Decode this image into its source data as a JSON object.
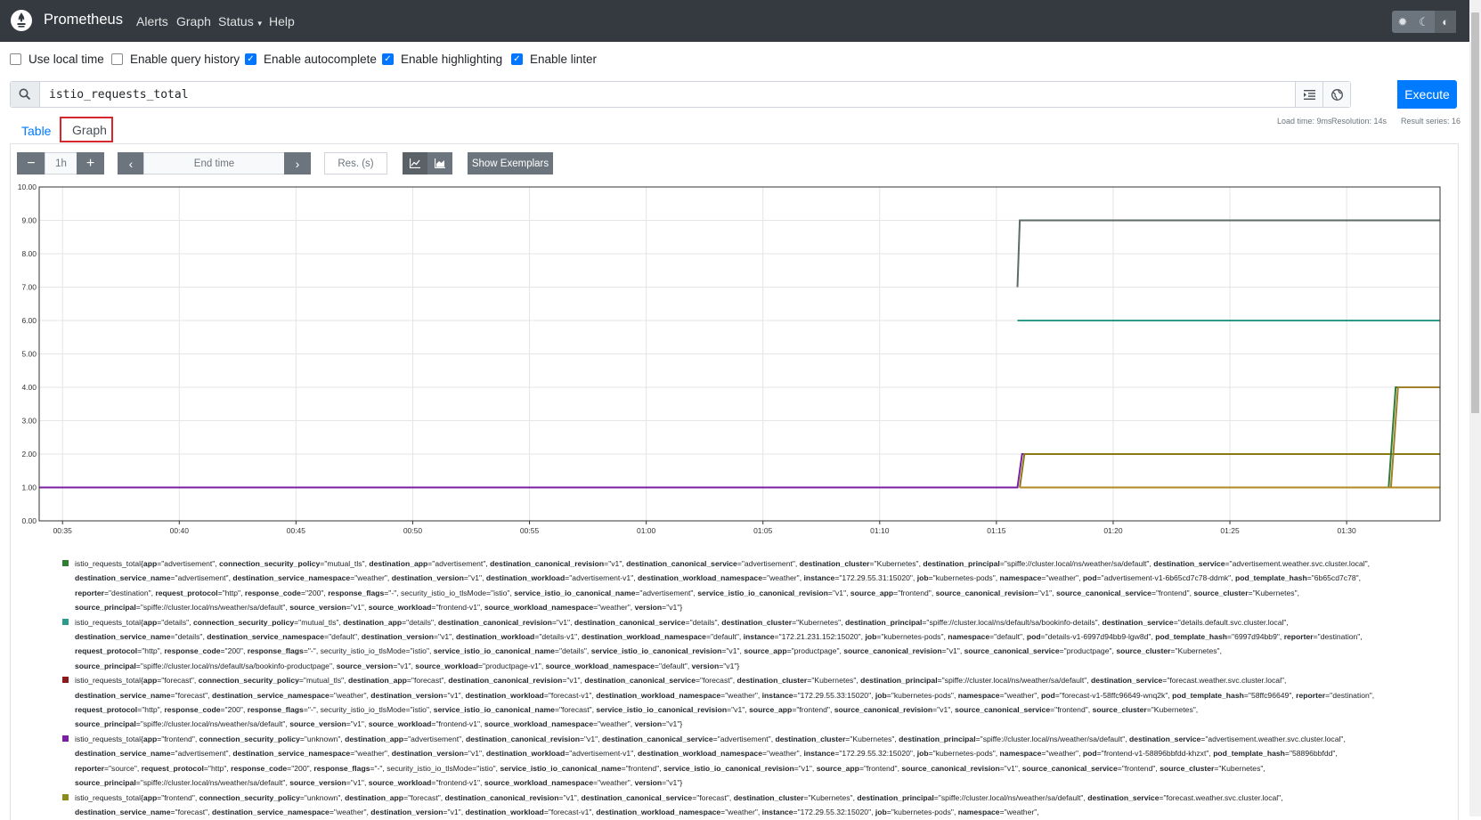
{
  "navbar": {
    "brand": "Prometheus",
    "links": [
      "Alerts",
      "Graph",
      "Status",
      "Help"
    ]
  },
  "options": [
    {
      "label": "Use local time",
      "checked": false
    },
    {
      "label": "Enable query history",
      "checked": false
    },
    {
      "label": "Enable autocomplete",
      "checked": true
    },
    {
      "label": "Enable highlighting",
      "checked": true
    },
    {
      "label": "Enable linter",
      "checked": true
    }
  ],
  "expression": "istio_requests_total",
  "execute_label": "Execute",
  "tabs": [
    "Table",
    "Graph"
  ],
  "stats": {
    "load_time": "Load time: 9ms",
    "resolution": "Resolution: 14s",
    "result_series": "Result series: 16"
  },
  "controls": {
    "range": "1h",
    "end_time_placeholder": "End time",
    "res_placeholder": "Res. (s)",
    "exemplars_label": "Show Exemplars"
  },
  "colors": {
    "execute": "#007bff",
    "navbar": "#343a40"
  },
  "chart_data": {
    "type": "line",
    "y_ticks": [
      "0.00",
      "1.00",
      "2.00",
      "3.00",
      "4.00",
      "5.00",
      "6.00",
      "7.00",
      "8.00",
      "9.00",
      "10.00"
    ],
    "x_ticks": [
      "00:35",
      "00:40",
      "00:45",
      "00:50",
      "00:55",
      "01:00",
      "01:05",
      "01:10",
      "01:15",
      "01:20",
      "01:25",
      "01:30"
    ],
    "ylim": [
      0,
      10
    ],
    "series": [
      {
        "color": "#5f6a68",
        "points": [
          [
            "01:15.9",
            7
          ],
          [
            "01:16.0",
            9
          ],
          [
            "01:34",
            9
          ]
        ]
      },
      {
        "color": "#2d9a8a",
        "points": [
          [
            "01:15.9",
            6
          ],
          [
            "01:34",
            6
          ]
        ]
      },
      {
        "color": "#7b1fa2",
        "points": [
          [
            "00:34",
            1
          ],
          [
            "01:15.9",
            1
          ],
          [
            "01:16.1",
            2
          ],
          [
            "01:34",
            2
          ]
        ]
      },
      {
        "color": "#8b7a14",
        "points": [
          [
            "01:16.0",
            1
          ],
          [
            "01:16.2",
            2
          ],
          [
            "01:34",
            2
          ]
        ]
      },
      {
        "color": "#2e7d32",
        "points": [
          [
            "01:31.8",
            1
          ],
          [
            "01:32.1",
            4
          ],
          [
            "01:34",
            4
          ]
        ]
      },
      {
        "color": "#a0802a",
        "points": [
          [
            "01:31.9",
            1
          ],
          [
            "01:32.2",
            4
          ],
          [
            "01:34",
            4
          ]
        ]
      },
      {
        "color": "#b08a20",
        "points": [
          [
            "01:16.0",
            1
          ],
          [
            "01:34",
            1
          ]
        ]
      }
    ]
  },
  "legend": [
    {
      "color": "#2e7d32",
      "text": "istio_requests_total{app=\"advertisement\", connection_security_policy=\"mutual_tls\", destination_app=\"advertisement\", destination_canonical_revision=\"v1\", destination_canonical_service=\"advertisement\", destination_cluster=\"Kubernetes\", destination_principal=\"spiffe://cluster.local/ns/weather/sa/default\", destination_service=\"advertisement.weather.svc.cluster.local\", destination_service_name=\"advertisement\", destination_service_namespace=\"weather\", destination_version=\"v1\", destination_workload=\"advertisement-v1\", destination_workload_namespace=\"weather\", instance=\"172.29.55.31:15020\", job=\"kubernetes-pods\", namespace=\"weather\", pod=\"advertisement-v1-6b65cd7c78-ddmk\", pod_template_hash=\"6b65cd7c78\", reporter=\"destination\", request_protocol=\"http\", response_code=\"200\", response_flags=\"-\", security_istio_io_tlsMode=\"istio\", service_istio_io_canonical_name=\"advertisement\", service_istio_io_canonical_revision=\"v1\", source_app=\"frontend\", source_canonical_revision=\"v1\", source_canonical_service=\"frontend\", source_cluster=\"Kubernetes\", source_principal=\"spiffe://cluster.local/ns/weather/sa/default\", source_version=\"v1\", source_workload=\"frontend-v1\", source_workload_namespace=\"weather\", version=\"v1\"}"
    },
    {
      "color": "#2d9a8a",
      "text": "istio_requests_total{app=\"details\", connection_security_policy=\"mutual_tls\", destination_app=\"details\", destination_canonical_revision=\"v1\", destination_canonical_service=\"details\", destination_cluster=\"Kubernetes\", destination_principal=\"spiffe://cluster.local/ns/default/sa/bookinfo-details\", destination_service=\"details.default.svc.cluster.local\", destination_service_name=\"details\", destination_service_namespace=\"default\", destination_version=\"v1\", destination_workload=\"details-v1\", destination_workload_namespace=\"default\", instance=\"172.21.231.152:15020\", job=\"kubernetes-pods\", namespace=\"default\", pod=\"details-v1-6997d94bb9-lgw8d\", pod_template_hash=\"6997d94bb9\", reporter=\"destination\", request_protocol=\"http\", response_code=\"200\", response_flags=\"-\", security_istio_io_tlsMode=\"istio\", service_istio_io_canonical_name=\"details\", service_istio_io_canonical_revision=\"v1\", source_app=\"productpage\", source_canonical_revision=\"v1\", source_canonical_service=\"productpage\", source_cluster=\"Kubernetes\", source_principal=\"spiffe://cluster.local/ns/default/sa/bookinfo-productpage\", source_version=\"v1\", source_workload=\"productpage-v1\", source_workload_namespace=\"default\", version=\"v1\"}"
    },
    {
      "color": "#8b1a1a",
      "text": "istio_requests_total{app=\"forecast\", connection_security_policy=\"mutual_tls\", destination_app=\"forecast\", destination_canonical_revision=\"v1\", destination_canonical_service=\"forecast\", destination_cluster=\"Kubernetes\", destination_principal=\"spiffe://cluster.local/ns/weather/sa/default\", destination_service=\"forecast.weather.svc.cluster.local\", destination_service_name=\"forecast\", destination_service_namespace=\"weather\", destination_version=\"v1\", destination_workload=\"forecast-v1\", destination_workload_namespace=\"weather\", instance=\"172.29.55.33:15020\", job=\"kubernetes-pods\", namespace=\"weather\", pod=\"forecast-v1-58ffc96649-wnq2k\", pod_template_hash=\"58ffc96649\", reporter=\"destination\", request_protocol=\"http\", response_code=\"200\", response_flags=\"-\", security_istio_io_tlsMode=\"istio\", service_istio_io_canonical_name=\"forecast\", service_istio_io_canonical_revision=\"v1\", source_app=\"frontend\", source_canonical_revision=\"v1\", source_canonical_service=\"frontend\", source_cluster=\"Kubernetes\", source_principal=\"spiffe://cluster.local/ns/weather/sa/default\", source_version=\"v1\", source_workload=\"frontend-v1\", source_workload_namespace=\"weather\", version=\"v1\"}"
    },
    {
      "color": "#7b1fa2",
      "text": "istio_requests_total{app=\"frontend\", connection_security_policy=\"unknown\", destination_app=\"advertisement\", destination_canonical_revision=\"v1\", destination_canonical_service=\"advertisement\", destination_cluster=\"Kubernetes\", destination_principal=\"spiffe://cluster.local/ns/weather/sa/default\", destination_service=\"advertisement.weather.svc.cluster.local\", destination_service_name=\"advertisement\", destination_service_namespace=\"weather\", destination_version=\"v1\", destination_workload=\"advertisement-v1\", destination_workload_namespace=\"weather\", instance=\"172.29.55.32:15020\", job=\"kubernetes-pods\", namespace=\"weather\", pod=\"frontend-v1-58896bbfdd-khzxt\", pod_template_hash=\"58896bbfdd\", reporter=\"source\", request_protocol=\"http\", response_code=\"200\", response_flags=\"-\", security_istio_io_tlsMode=\"istio\", service_istio_io_canonical_name=\"frontend\", service_istio_io_canonical_revision=\"v1\", source_app=\"frontend\", source_canonical_revision=\"v1\", source_canonical_service=\"frontend\", source_cluster=\"Kubernetes\", source_principal=\"spiffe://cluster.local/ns/weather/sa/default\", source_version=\"v1\", source_workload=\"frontend-v1\", source_workload_namespace=\"weather\", version=\"v1\"}"
    },
    {
      "color": "#8b8b1a",
      "text": "istio_requests_total{app=\"frontend\", connection_security_policy=\"unknown\", destination_app=\"forecast\", destination_canonical_revision=\"v1\", destination_canonical_service=\"forecast\", destination_cluster=\"Kubernetes\", destination_principal=\"spiffe://cluster.local/ns/weather/sa/default\", destination_service=\"forecast.weather.svc.cluster.local\", destination_service_name=\"forecast\", destination_service_namespace=\"weather\", destination_version=\"v1\", destination_workload=\"forecast-v1\", destination_workload_namespace=\"weather\", instance=\"172.29.55.32:15020\", job=\"kubernetes-pods\", namespace=\"weather\","
    }
  ]
}
